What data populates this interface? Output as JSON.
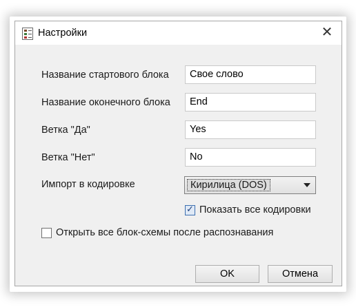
{
  "window": {
    "title": "Настройки"
  },
  "fields": [
    {
      "label": "Название стартового блока",
      "value": "Свое слово"
    },
    {
      "label": "Название оконечного блока",
      "value": "End"
    },
    {
      "label": "Ветка \"Да\"",
      "value": "Yes"
    },
    {
      "label": "Ветка \"Нет\"",
      "value": "No"
    }
  ],
  "encoding": {
    "label": "Импорт в кодировке",
    "selected": "Кирилица (DOS)"
  },
  "checkboxes": {
    "show_all_encodings": {
      "label": "Показать все кодировки",
      "checked": true
    },
    "open_all_flowcharts": {
      "label": "Открыть все блок-схемы после распознавания",
      "checked": false
    }
  },
  "buttons": {
    "ok": "OK",
    "cancel": "Отмена"
  }
}
